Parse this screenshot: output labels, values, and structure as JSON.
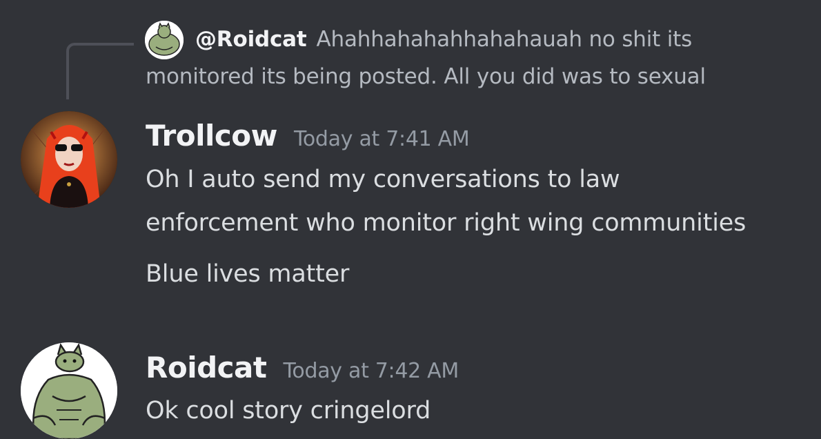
{
  "reply": {
    "author": "@Roidcat",
    "text": "Ahahhahahahhahahauah no shit its monitored its being posted.  All you did was to sexual"
  },
  "messages": [
    {
      "author": "Trollcow",
      "timestamp": "Today at 7:41 AM",
      "lines": [
        "Oh I auto send my conversations to law",
        "enforcement who monitor right wing communities",
        "Blue lives matter"
      ]
    },
    {
      "author": "Roidcat",
      "timestamp": "Today at 7:42 AM",
      "lines": [
        "Ok cool story cringelord"
      ]
    }
  ],
  "colors": {
    "background": "#313338",
    "username": "#f2f3f5",
    "timestamp": "#949ba4",
    "message_text": "#dbdee1",
    "reply_text": "#b5bac1"
  }
}
